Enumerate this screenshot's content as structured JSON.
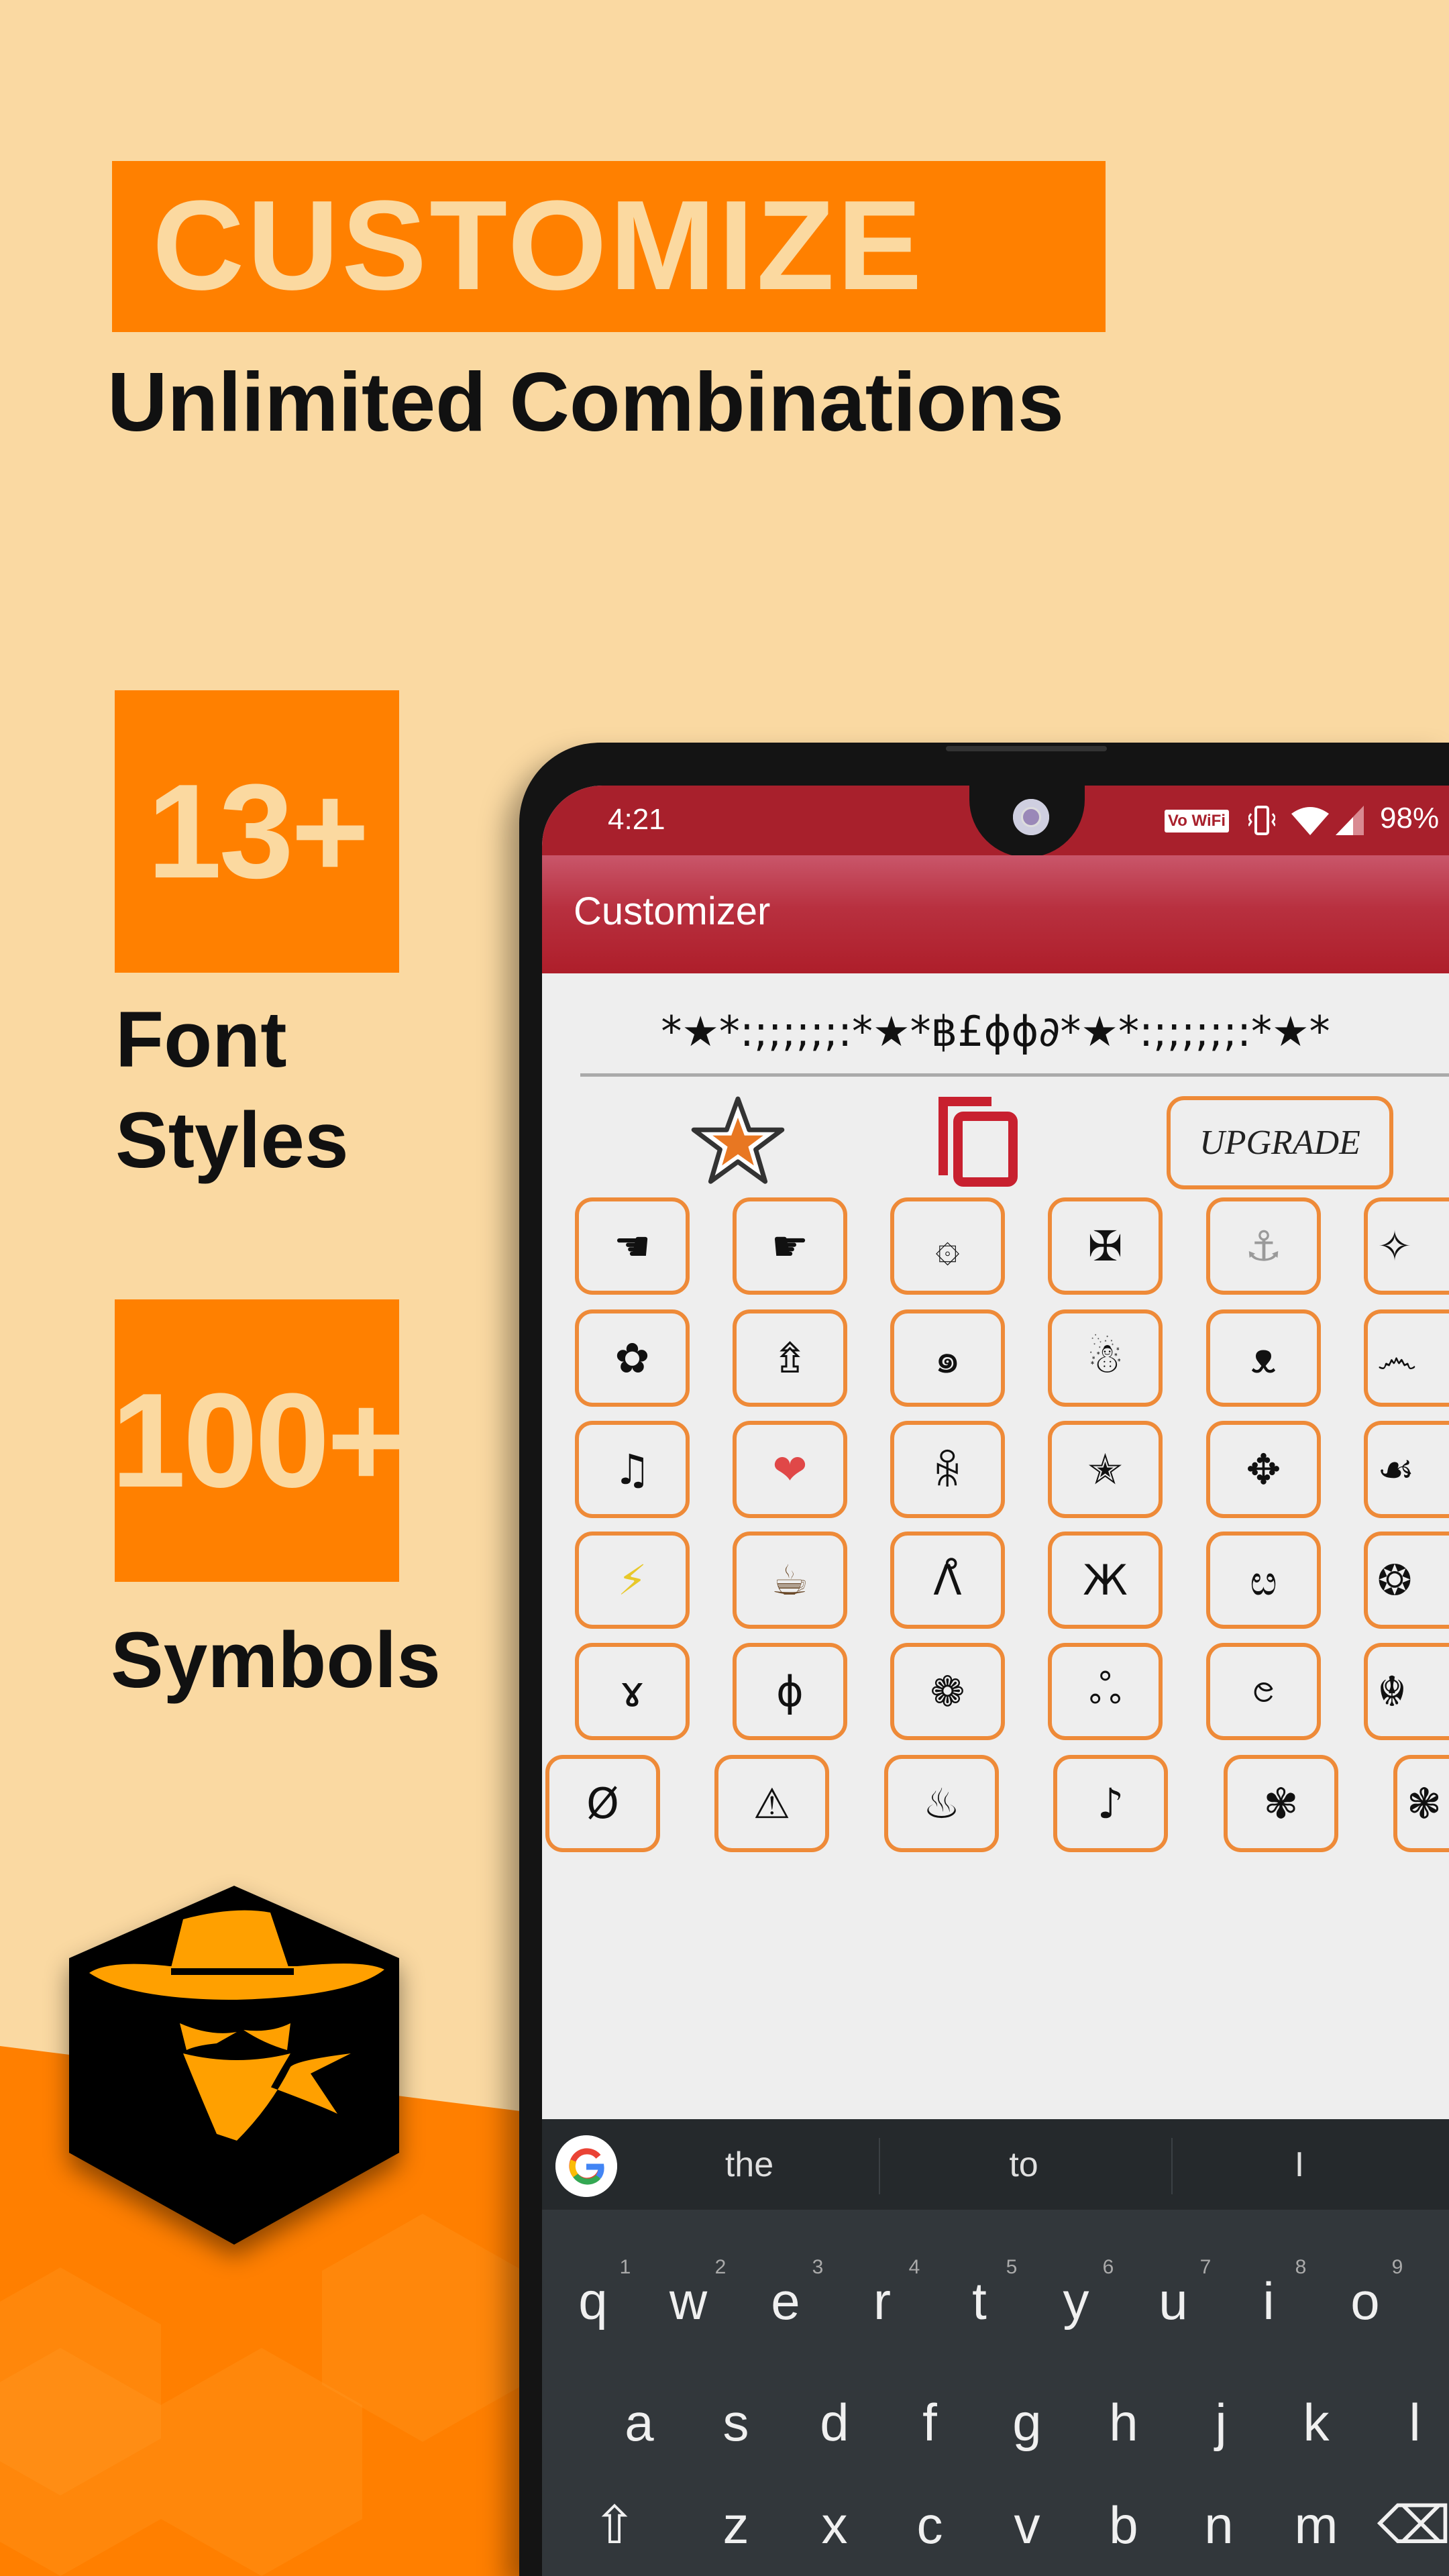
{
  "promo": {
    "headline": "CUSTOMIZE",
    "subtitle": "Unlimited Combinations",
    "stats": [
      {
        "value": "13+",
        "label_line1": "Font",
        "label_line2": "Styles"
      },
      {
        "value": "100+",
        "label_line1": "Symbols",
        "label_line2": ""
      }
    ]
  },
  "colors": {
    "accent": "#FF8000",
    "background": "#FAD9A2",
    "app_bar": "#A8202C",
    "cell_border": "#EE8A38",
    "keyboard": "#32373B"
  },
  "status_bar": {
    "time": "4:21",
    "vowifi": "Vo WiFi",
    "battery": "98%"
  },
  "app": {
    "title": "Customizer",
    "styled_text": "*★*:;;;;;;:*★*฿£ɸɸ∂*★*:;;;;;;:*★*",
    "upgrade_label": "UPGRADE",
    "icons": [
      "star-icon",
      "copy-icon"
    ]
  },
  "symbols": [
    [
      {
        "s": "☚"
      },
      {
        "s": "☛"
      },
      {
        "s": "۞"
      },
      {
        "s": "✠"
      },
      {
        "s": "⚓",
        "color": "#9a9a9a"
      },
      {
        "s": "✧"
      }
    ],
    [
      {
        "s": "✿"
      },
      {
        "s": "⇯"
      },
      {
        "s": "๑"
      },
      {
        "s": "☃"
      },
      {
        "s": "ᴥ"
      },
      {
        "s": "෴"
      }
    ],
    [
      {
        "s": "♫"
      },
      {
        "s": "❤",
        "color": "#E04848"
      },
      {
        "s": "ꆜ"
      },
      {
        "s": "✭"
      },
      {
        "s": "✥"
      },
      {
        "s": "☙"
      }
    ],
    [
      {
        "s": "⚡",
        "color": "#E8C82A"
      },
      {
        "s": "☕",
        "color": "#6b4a2a"
      },
      {
        "s": "Λ̊"
      },
      {
        "s": "Ж"
      },
      {
        "s": "ೞ"
      },
      {
        "s": "❂"
      }
    ],
    [
      {
        "s": "ɤ"
      },
      {
        "s": "ɸ"
      },
      {
        "s": "❁"
      },
      {
        "s": "ஃ"
      },
      {
        "s": "ၔ"
      },
      {
        "s": "☬"
      }
    ],
    [
      {
        "s": "Ø"
      },
      {
        "s": "⚠"
      },
      {
        "s": "♨"
      },
      {
        "s": "♪"
      },
      {
        "s": "✾"
      },
      {
        "s": "❃"
      }
    ]
  ],
  "keyboard": {
    "suggestions": [
      "the",
      "to",
      "I"
    ],
    "rows": [
      [
        {
          "k": "q",
          "n": "1"
        },
        {
          "k": "w",
          "n": "2"
        },
        {
          "k": "e",
          "n": "3"
        },
        {
          "k": "r",
          "n": "4"
        },
        {
          "k": "t",
          "n": "5"
        },
        {
          "k": "y",
          "n": "6"
        },
        {
          "k": "u",
          "n": "7"
        },
        {
          "k": "i",
          "n": "8"
        },
        {
          "k": "o",
          "n": "9"
        }
      ],
      [
        {
          "k": "a"
        },
        {
          "k": "s"
        },
        {
          "k": "d"
        },
        {
          "k": "f"
        },
        {
          "k": "g"
        },
        {
          "k": "h"
        },
        {
          "k": "j"
        },
        {
          "k": "k"
        },
        {
          "k": "l"
        }
      ],
      [
        {
          "k": "⇧"
        },
        {
          "k": "z"
        },
        {
          "k": "x"
        },
        {
          "k": "c"
        },
        {
          "k": "v"
        },
        {
          "k": "b"
        },
        {
          "k": "n"
        },
        {
          "k": "m"
        },
        {
          "k": "⌫"
        }
      ]
    ]
  }
}
